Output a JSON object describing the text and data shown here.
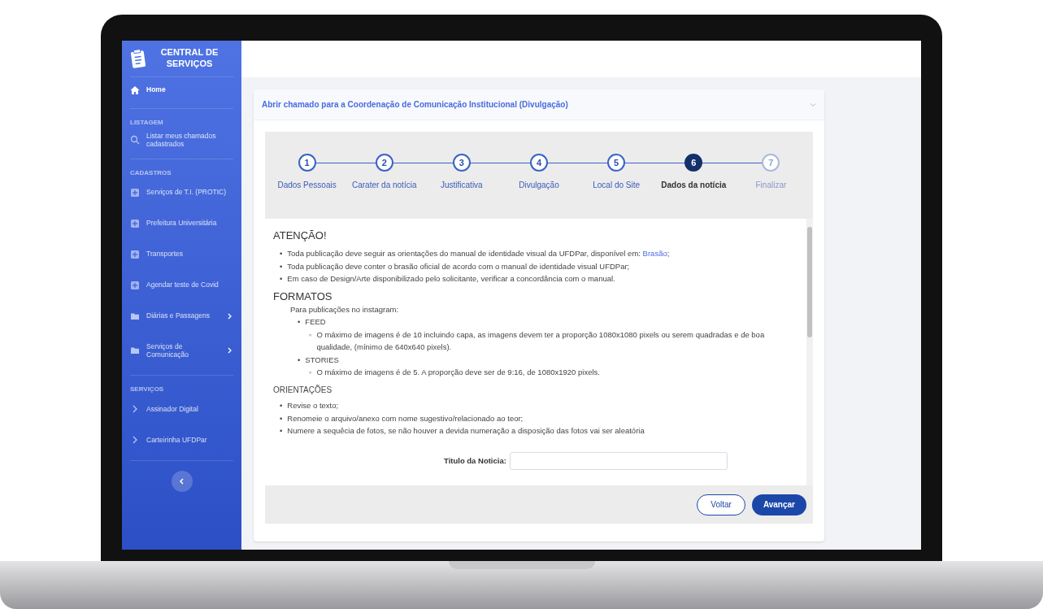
{
  "sidebar": {
    "brand": "CENTRAL DE SERVIÇOS",
    "items": [
      {
        "kind": "main",
        "label": "Home",
        "expandable": false
      },
      {
        "kind": "section",
        "label": "LISTAGEM"
      },
      {
        "kind": "listing",
        "label": "Listar meus chamados cadastrados",
        "expandable": false
      },
      {
        "kind": "section",
        "label": "CADASTROS"
      },
      {
        "kind": "register",
        "label": "Serviços de T.I. (PROTIC)",
        "expandable": false
      },
      {
        "kind": "register",
        "label": "Prefeitura Universitária",
        "expandable": false
      },
      {
        "kind": "register",
        "label": "Transportes",
        "expandable": false
      },
      {
        "kind": "register",
        "label": "Agendar teste de Covid",
        "expandable": false
      },
      {
        "kind": "group",
        "label": "Diárias e Passagens",
        "expandable": true
      },
      {
        "kind": "group",
        "label": "Serviços de Comunicação",
        "expandable": true
      },
      {
        "kind": "section",
        "label": "SERVIÇOS"
      },
      {
        "kind": "service",
        "label": "Assinador Digital",
        "expandable": false
      },
      {
        "kind": "service",
        "label": "Carteirinha UFDPar",
        "expandable": false
      }
    ]
  },
  "card": {
    "title": "Abrir chamado para a Coordenação de Comunicação Institucional (Divulgação)",
    "steps": [
      {
        "number": "1",
        "label": "Dados Pessoais",
        "selected": false,
        "disabled": false
      },
      {
        "number": "2",
        "label": "Carater da notícia",
        "selected": false,
        "disabled": false
      },
      {
        "number": "3",
        "label": "Justificativa",
        "selected": false,
        "disabled": false
      },
      {
        "number": "4",
        "label": "Divulgação",
        "selected": false,
        "disabled": false
      },
      {
        "number": "5",
        "label": "Local do Site",
        "selected": false,
        "disabled": false
      },
      {
        "number": "6",
        "label": "Dados da notícia",
        "selected": true,
        "disabled": false
      },
      {
        "number": "7",
        "label": "Finalizar",
        "selected": false,
        "disabled": true
      }
    ],
    "attention": {
      "heading": "ATENÇÃO!",
      "items": [
        {
          "marker": "•",
          "text": "Toda publicação deve seguir as orientações do manual de identidade visual da UFDPar, disponível em:",
          "link": "Brasão",
          "after": ";"
        },
        {
          "marker": "•",
          "text": "Toda publicação deve conter o brasão oficial de acordo com o manual de identidade visual UFDPar;"
        },
        {
          "marker": "•",
          "text": "Em caso de Design/Arte disponibilizado pelo solicitante, verificar a concordância com o manual."
        }
      ]
    },
    "formats": {
      "heading": "FORMATOS",
      "intro": "Para publicações no instagram:",
      "items": [
        {
          "marker": "•",
          "label": "FEED",
          "details": [
            {
              "marker": "◦",
              "text": "O máximo de imagens é de 10 incluindo capa, as imagens devem ter a proporção 1080x1080 pixels ou serem quadradas e de boa qualidade, (mínimo de 640x640 pixels)."
            }
          ]
        },
        {
          "marker": "•",
          "label": "STORIES",
          "details": [
            {
              "marker": "◦",
              "text": "O máximo de imagens é de 5. A proporção deve ser de 9:16, de 1080x1920 pixels."
            }
          ]
        }
      ]
    },
    "guidelines": {
      "heading": "ORIENTAÇÕES",
      "items": [
        {
          "marker": "•",
          "text": "Revise o texto;"
        },
        {
          "marker": "•",
          "text": "Renomeie o arquivo/anexo com nome sugestivo/relacionado ao teor;"
        },
        {
          "marker": "•",
          "text": "Numere a sequêcia de fotos, se não houver a devida numeração a disposição das fotos vai ser aleatória"
        }
      ]
    },
    "field": {
      "label": "Titulo da Noticia:"
    },
    "buttons": [
      {
        "kind": "secondary",
        "label": "Voltar"
      },
      {
        "kind": "primary",
        "label": "Avançar"
      }
    ]
  }
}
